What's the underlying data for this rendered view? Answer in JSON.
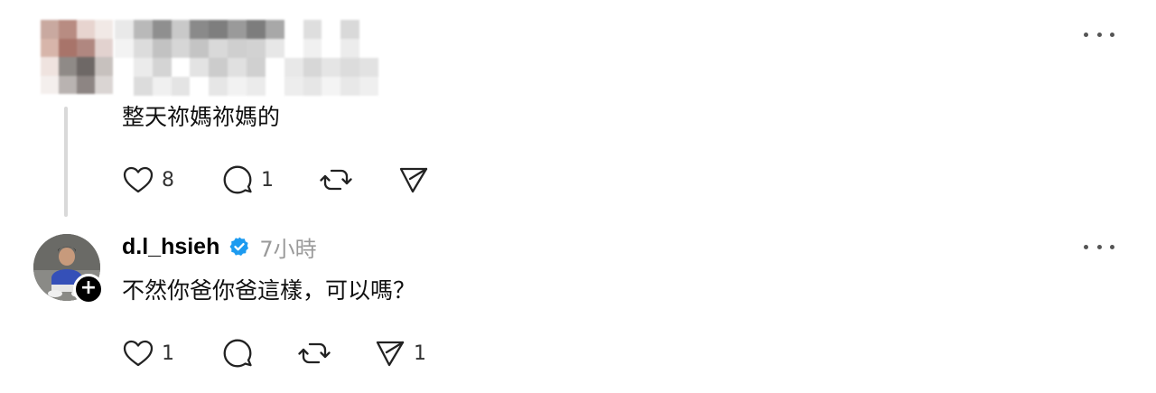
{
  "comment1": {
    "body": "整天祢媽祢媽的",
    "actions": {
      "like_count": "8",
      "reply_count": "1",
      "like_icon": "heart-icon",
      "reply_icon": "comment-bubble-icon",
      "repost_icon": "repost-icon",
      "share_icon": "send-icon"
    }
  },
  "comment2": {
    "username": "d.l_hsieh",
    "timestamp": "7小時",
    "body": "不然你爸你爸這樣，可以嗎？",
    "verified_icon": "verified-badge-icon",
    "follow_icon": "plus-icon",
    "actions": {
      "like_count": "1",
      "share_count": "1"
    }
  },
  "colors": {
    "verified": "#1d9bf0",
    "muted_text": "#9a9a9a",
    "icon_stroke": "#222222",
    "thread_line": "#d9d9d9"
  }
}
